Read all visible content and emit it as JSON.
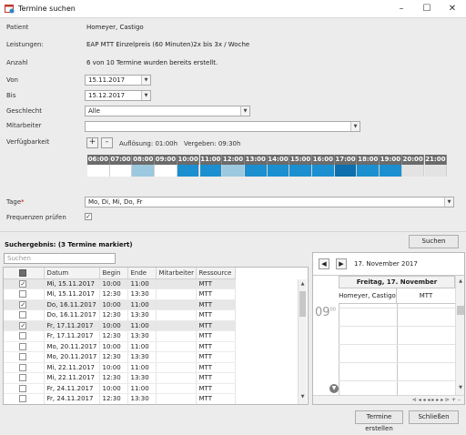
{
  "window": {
    "title": "Termine suchen",
    "controls": [
      "–",
      "☐",
      "✕"
    ]
  },
  "form": {
    "patient_label": "Patient",
    "patient_value": "Homeyer, Castigo",
    "leistungen_label": "Leistungen:",
    "leistungen_value": "EAP MTT Einzelpreis (60 Minuten)2x bis 3x / Woche",
    "anzahl_label": "Anzahl",
    "anzahl_value": "6 von 10 Termine wurden bereits erstellt.",
    "von_label": "Von",
    "von_value": "15.11.2017",
    "bis_label": "Bis",
    "bis_value": "15.12.2017",
    "geschlecht_label": "Geschlecht",
    "geschlecht_value": "Alle",
    "mitarbeiter_label": "Mitarbeiter",
    "mitarbeiter_value": "",
    "verfuegbarkeit_label": "Verfügbarkeit",
    "plus_label": "+",
    "minus_label": "-",
    "aufloesung": "Auflösung: 01:00h",
    "vergeben": "Vergeben: 09:30h",
    "tage_label": "Tage",
    "tage_required": "*",
    "tage_value": "Mo, Di, Mi, Do, Fr",
    "frequenzen_label": "Frequenzen prüfen",
    "frequenzen_checked": "✓",
    "suchen_button": "Suchen"
  },
  "availability": {
    "hours": [
      "06:00",
      "07:00",
      "08:00",
      "09:00",
      "10:00",
      "11:00",
      "12:00",
      "13:00",
      "14:00",
      "15:00",
      "16:00",
      "17:00",
      "18:00",
      "19:00",
      "20:00",
      "21:00"
    ],
    "levels": [
      "none",
      "none",
      "light",
      "none",
      "medium",
      "medium",
      "light",
      "medium",
      "medium",
      "medium",
      "medium",
      "dark",
      "medium",
      "medium",
      "grey",
      "grey"
    ],
    "colors": {
      "none": "#ffffff",
      "light": "#9cc8e0",
      "medium": "#1b8fd0",
      "dark": "#0d6fad",
      "grey": "#e3e3e3",
      "hour_header": "#6b6b6b"
    }
  },
  "results": {
    "title": "Suchergebnis: (3 Termine markiert)",
    "search_placeholder": "Suchen",
    "columns": [
      "",
      "Datum",
      "Begin",
      "Ende",
      "Mitarbeiter",
      "Ressource"
    ],
    "rows": [
      {
        "check": "✓",
        "datum": "Mi, 15.11.2017",
        "begin": "10:00",
        "ende": "11:00",
        "mitarbeiter": "",
        "ressource": "MTT",
        "marked": true
      },
      {
        "check": "",
        "datum": "Mi, 15.11.2017",
        "begin": "12:30",
        "ende": "13:30",
        "mitarbeiter": "",
        "ressource": "MTT",
        "marked": false
      },
      {
        "check": "✓",
        "datum": "Do, 16.11.2017",
        "begin": "10:00",
        "ende": "11:00",
        "mitarbeiter": "",
        "ressource": "MTT",
        "marked": true
      },
      {
        "check": "",
        "datum": "Do, 16.11.2017",
        "begin": "12:30",
        "ende": "13:30",
        "mitarbeiter": "",
        "ressource": "MTT",
        "marked": false
      },
      {
        "check": "✓",
        "datum": "Fr, 17.11.2017",
        "begin": "10:00",
        "ende": "11:00",
        "mitarbeiter": "",
        "ressource": "MTT",
        "marked": true
      },
      {
        "check": "",
        "datum": "Fr, 17.11.2017",
        "begin": "12:30",
        "ende": "13:30",
        "mitarbeiter": "",
        "ressource": "MTT",
        "marked": false
      },
      {
        "check": "",
        "datum": "Mo, 20.11.2017",
        "begin": "10:00",
        "ende": "11:00",
        "mitarbeiter": "",
        "ressource": "MTT",
        "marked": false
      },
      {
        "check": "",
        "datum": "Mo, 20.11.2017",
        "begin": "12:30",
        "ende": "13:30",
        "mitarbeiter": "",
        "ressource": "MTT",
        "marked": false
      },
      {
        "check": "",
        "datum": "Mi, 22.11.2017",
        "begin": "10:00",
        "ende": "11:00",
        "mitarbeiter": "",
        "ressource": "MTT",
        "marked": false
      },
      {
        "check": "",
        "datum": "Mi, 22.11.2017",
        "begin": "12:30",
        "ende": "13:30",
        "mitarbeiter": "",
        "ressource": "MTT",
        "marked": false
      },
      {
        "check": "",
        "datum": "Fr, 24.11.2017",
        "begin": "10:00",
        "ende": "11:00",
        "mitarbeiter": "",
        "ressource": "MTT",
        "marked": false
      },
      {
        "check": "",
        "datum": "Fr, 24.11.2017",
        "begin": "12:30",
        "ende": "13:30",
        "mitarbeiter": "",
        "ressource": "MTT",
        "marked": false
      }
    ]
  },
  "calendar": {
    "nav_prev": "◀",
    "nav_next": "▶",
    "date_label": "17. November 2017",
    "day_header": "Freitag, 17. November",
    "col1": "Homeyer, Castigo",
    "col2": "MTT",
    "hour": "09",
    "minutes": "00",
    "scroll_controls": "⊲ ◂ ◂ ◂ ▸ ▸ ▸ ⊳ + –"
  },
  "footer": {
    "create_button": "Termine erstellen",
    "close_button": "Schließen"
  }
}
